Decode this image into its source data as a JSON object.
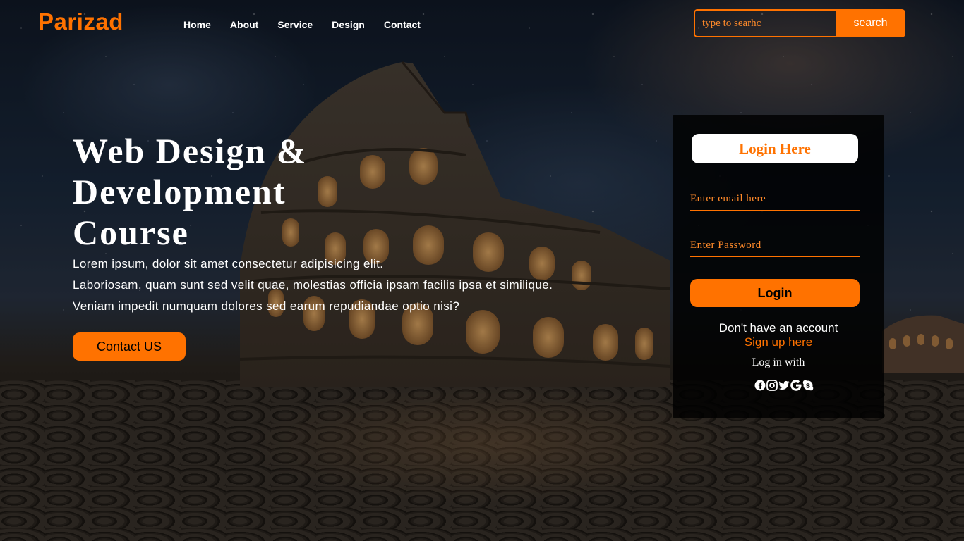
{
  "brand": {
    "logo": "Parizad",
    "accent_color": "#ff7200"
  },
  "nav": {
    "items": [
      "Home",
      "About",
      "Service",
      "Design",
      "Contact"
    ]
  },
  "search": {
    "placeholder": "type to searhc",
    "button_label": "search"
  },
  "hero": {
    "title_lines": [
      "Web Design &",
      "Development",
      "Course"
    ],
    "paragraph_lines": [
      "Lorem ipsum, dolor sit amet consectetur adipisicing elit.",
      "Laboriosam, quam sunt sed velit quae, molestias officia ipsam facilis ipsa et similique.",
      "Veniam impedit numquam dolores sed earum repudiandae optio nisi?"
    ],
    "cta_label": "Contact US"
  },
  "login": {
    "title": "Login Here",
    "email_placeholder": "Enter email here",
    "password_placeholder": "Enter Password",
    "button_label": "Login",
    "no_account_text": "Don't have an account",
    "signup_link": "Sign up here",
    "login_with_text": "Log in with",
    "social_icons": [
      "facebook-icon",
      "instagram-icon",
      "twitter-icon",
      "google-icon",
      "skype-icon"
    ]
  }
}
